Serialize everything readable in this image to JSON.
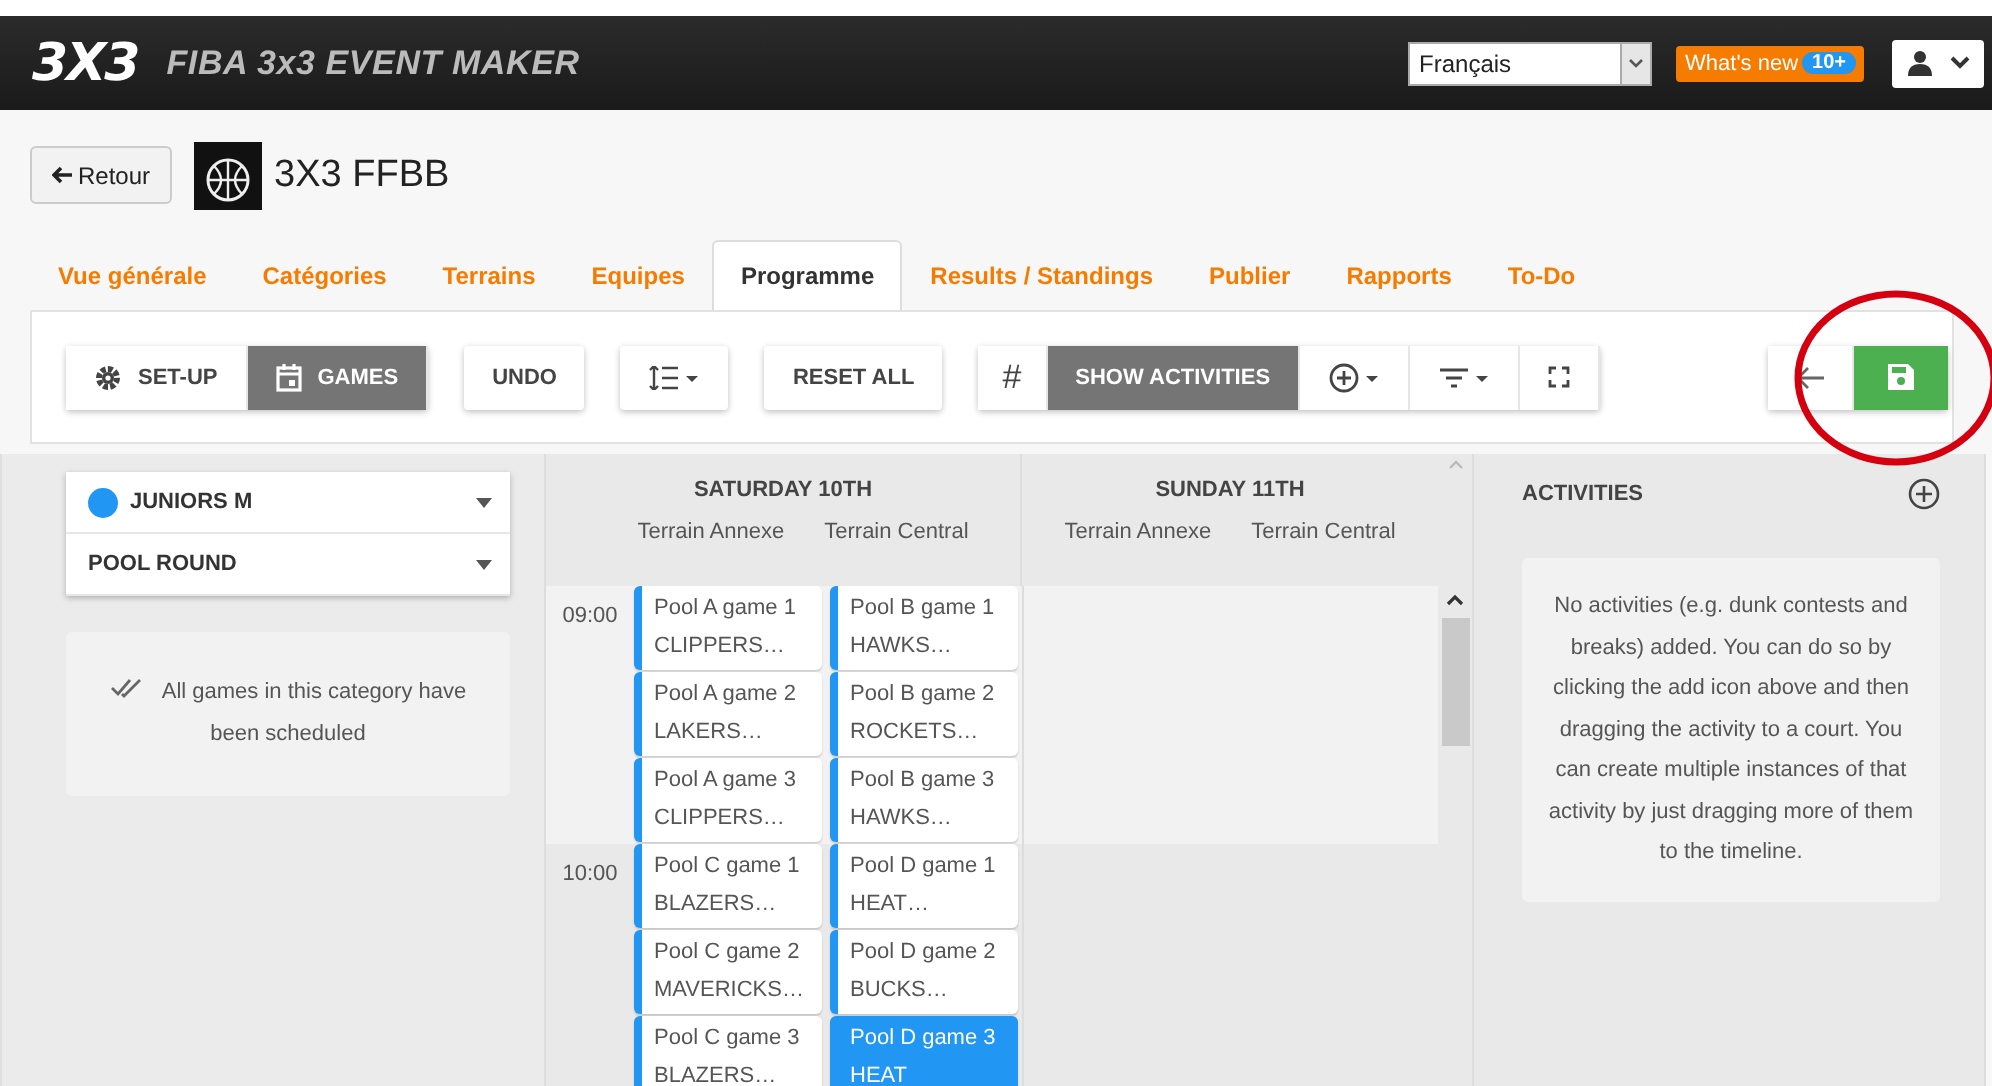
{
  "header": {
    "logo": "3X3",
    "app_title": "FIBA 3x3 EVENT MAKER",
    "language": "Français",
    "whats_new": {
      "label": "What's new",
      "badge": "10+"
    }
  },
  "event": {
    "back_button": "Retour",
    "name": "3X3 FFBB"
  },
  "tabs": [
    {
      "label": "Vue générale",
      "selected": false
    },
    {
      "label": "Catégories",
      "selected": false
    },
    {
      "label": "Terrains",
      "selected": false
    },
    {
      "label": "Equipes",
      "selected": false
    },
    {
      "label": "Programme",
      "selected": true
    },
    {
      "label": "Results / Standings",
      "selected": false
    },
    {
      "label": "Publier",
      "selected": false
    },
    {
      "label": "Rapports",
      "selected": false
    },
    {
      "label": "To-Do",
      "selected": false
    }
  ],
  "toolbar": {
    "modes": [
      {
        "label": "SET-UP",
        "kind": "gear",
        "selected": false
      },
      {
        "label": "GAMES",
        "kind": "calendar",
        "selected": true
      }
    ],
    "undo": "UNDO",
    "reset": "RESET ALL",
    "activities_toggle": {
      "symbol": "#",
      "label": "SHOW ACTIVITIES",
      "on": true
    }
  },
  "sidebar": {
    "category": {
      "label": "JUNIORS M",
      "color": "#2196f3"
    },
    "round": "POOL ROUND",
    "message": "All games in this category have been scheduled"
  },
  "schedule": {
    "days": [
      {
        "title": "SATURDAY 10TH",
        "courts": [
          "Terrain Annexe",
          "Terrain Central"
        ]
      },
      {
        "title": "SUNDAY 11TH",
        "courts": [
          "Terrain Annexe",
          "Terrain Central"
        ]
      }
    ],
    "slots": [
      {
        "time": "09:00",
        "rows": [
          [
            {
              "title": "Pool A game 1",
              "teams": "CLIPPERS…",
              "selected": false
            },
            {
              "title": "Pool B game 1",
              "teams": "HAWKS…",
              "selected": false
            }
          ],
          [
            {
              "title": "Pool A game 2",
              "teams": "LAKERS…",
              "selected": false
            },
            {
              "title": "Pool B game 2",
              "teams": "ROCKETS…",
              "selected": false
            }
          ],
          [
            {
              "title": "Pool A game 3",
              "teams": "CLIPPERS…",
              "selected": false
            },
            {
              "title": "Pool B game 3",
              "teams": "HAWKS…",
              "selected": false
            }
          ]
        ]
      },
      {
        "time": "10:00",
        "rows": [
          [
            {
              "title": "Pool C game 1",
              "teams": "BLAZERS…",
              "selected": false
            },
            {
              "title": "Pool D game 1",
              "teams": "HEAT…",
              "selected": false
            }
          ],
          [
            {
              "title": "Pool C game 2",
              "teams": "MAVERICKS…",
              "selected": false
            },
            {
              "title": "Pool D game 2",
              "teams": "BUCKS…",
              "selected": false
            }
          ],
          [
            {
              "title": "Pool C game 3",
              "teams": "BLAZERS…",
              "selected": false
            },
            {
              "title": "Pool D game 3",
              "teams": "HEAT",
              "selected": true
            }
          ]
        ]
      }
    ]
  },
  "activities": {
    "title": "ACTIVITIES",
    "message": "No activities (e.g. dunk contests and breaks) added. You can do so by clicking the add icon above and then dragging the activity to a court. You can create multiple instances of that activity by just dragging more of them to the timeline."
  }
}
